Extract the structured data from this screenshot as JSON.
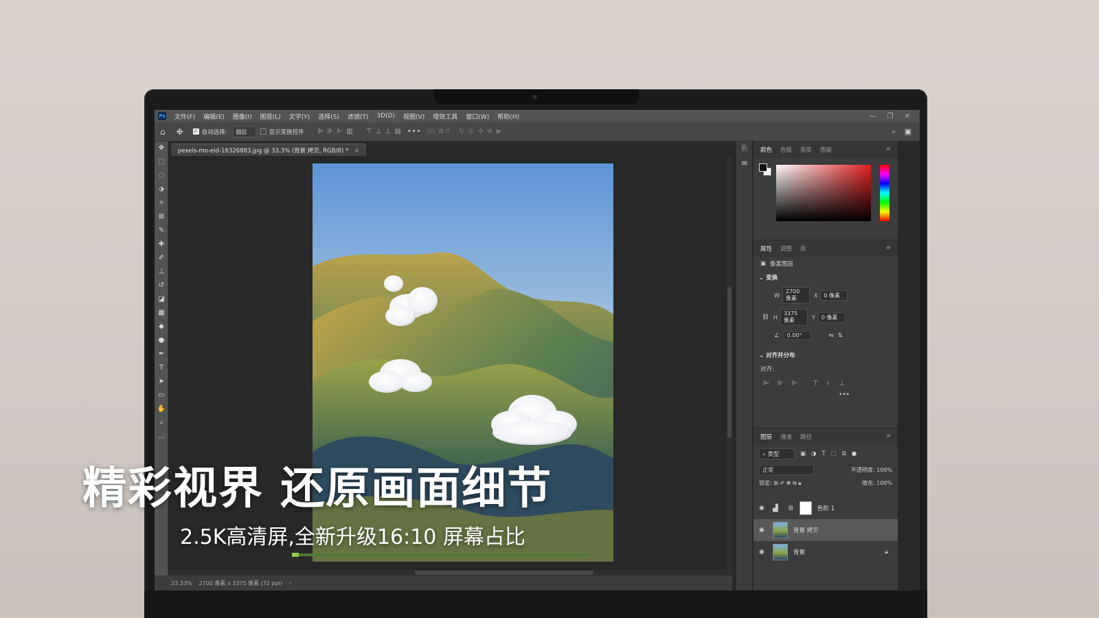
{
  "app": {
    "logo": "Ps",
    "menu": [
      "文件(F)",
      "编辑(E)",
      "图像(I)",
      "图层(L)",
      "文字(Y)",
      "选择(S)",
      "滤镜(T)",
      "3D(D)",
      "视图(V)",
      "增效工具",
      "窗口(W)",
      "帮助(H)"
    ],
    "window_controls": [
      "—",
      "❐",
      "✕"
    ]
  },
  "options_bar": {
    "auto_select_label": "自动选择:",
    "auto_select_value": "图层",
    "show_transform_label": "显示变换控件",
    "more": "•••",
    "mode_3d": "3D 模式:"
  },
  "document": {
    "tab_title": "pexels-mo-eid-16326883.jpg @ 33.3% (背景 拷贝, RGB/8) *",
    "close": "×",
    "zoom": "33.33%",
    "info": "2700 像素 x 3375 像素 (72 ppi)",
    "info_arrow": "›"
  },
  "color_panel": {
    "tabs": [
      "颜色",
      "色板",
      "渐变",
      "图案"
    ],
    "fg": "#111111",
    "bg": "#ffffff"
  },
  "properties_panel": {
    "tabs": [
      "属性",
      "调整",
      "库"
    ],
    "layer_type": "像素图层",
    "transform_title": "变换",
    "w_label": "W",
    "w_value": "2700 像素",
    "x_label": "X",
    "x_value": "0 像素",
    "h_label": "H",
    "h_value": "3375 像素",
    "y_label": "Y",
    "y_value": "0 像素",
    "angle": "0.00°",
    "align_title": "对齐并分布",
    "align_label": "对齐:",
    "more": "•••"
  },
  "layers_panel": {
    "tabs": [
      "图层",
      "通道",
      "路径"
    ],
    "filter": "类型",
    "blend_mode": "正常",
    "opacity_label": "不透明度:",
    "opacity": "100%",
    "lock_label": "锁定:",
    "fill_label": "填充:",
    "fill": "100%",
    "layers": [
      {
        "name": "色阶 1"
      },
      {
        "name": "背景 拷贝"
      },
      {
        "name": "背景"
      }
    ]
  },
  "caption": {
    "main": "精彩视界 还原画面细节",
    "sub": "2.5K高清屏,全新升级16:10 屏幕占比"
  }
}
